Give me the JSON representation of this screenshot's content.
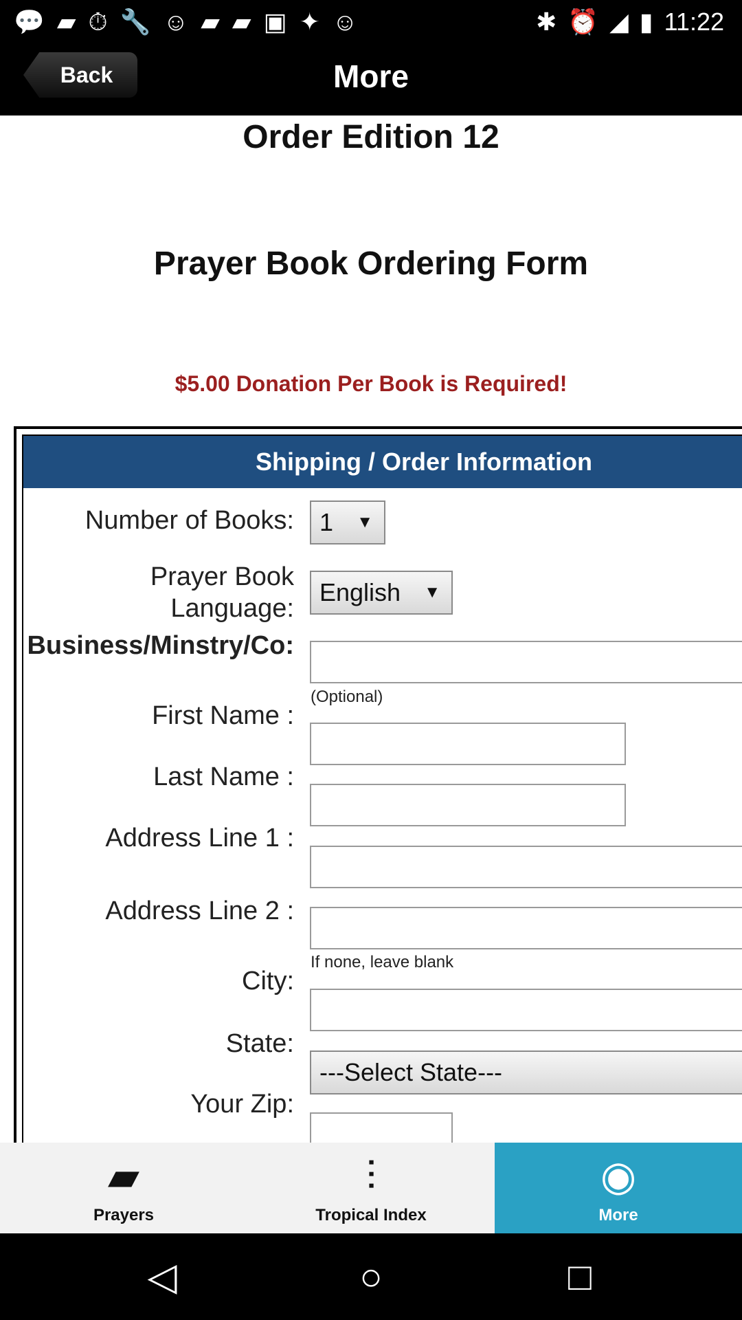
{
  "status_bar": {
    "left_icons": [
      "messages-icon",
      "flipboard-icon",
      "timer-icon",
      "wrench-icon",
      "smiley-icon",
      "flipboard-icon",
      "flipboard-icon",
      "qt-icon",
      "app-icon",
      "smiley-icon"
    ],
    "right_icons": [
      "bluetooth-icon",
      "alarm-icon",
      "signal-icon",
      "battery-icon"
    ],
    "time": "11:22"
  },
  "header": {
    "back_label": "Back",
    "title": "More"
  },
  "content": {
    "edition_title": "Order Edition 12",
    "form_title": "Prayer Book Ordering Form",
    "donation_notice": "$5.00 Donation Per Book is Required!",
    "section_title": "Shipping / Order Information",
    "fields": {
      "books_label": "Number of Books:",
      "books_value": "1",
      "language_label_1": "Prayer Book",
      "language_label_2": "Language:",
      "language_value": "English",
      "business_label": "Business/Minstry/Co:",
      "business_hint": "(Optional)",
      "first_name_label": "First Name :",
      "last_name_label": "Last Name :",
      "address1_label": "Address Line 1 :",
      "address2_label": "Address Line 2 :",
      "address2_hint": "If none, leave blank",
      "city_label": "City:",
      "state_label": "State:",
      "state_value": "---Select State---",
      "zip_label": "Your Zip:"
    }
  },
  "tabs": [
    {
      "label": "Prayers",
      "icon": "book-icon",
      "active": false
    },
    {
      "label": "Tropical Index",
      "icon": "sliders-icon",
      "active": false
    },
    {
      "label": "More",
      "icon": "more-dots-icon",
      "active": true
    }
  ],
  "nav": {
    "back": "back-icon",
    "home": "home-icon",
    "recents": "recents-icon"
  },
  "colors": {
    "section_bar": "#1f4e80",
    "donation_text": "#9b1f1f",
    "active_tab": "#2aa1c4"
  }
}
